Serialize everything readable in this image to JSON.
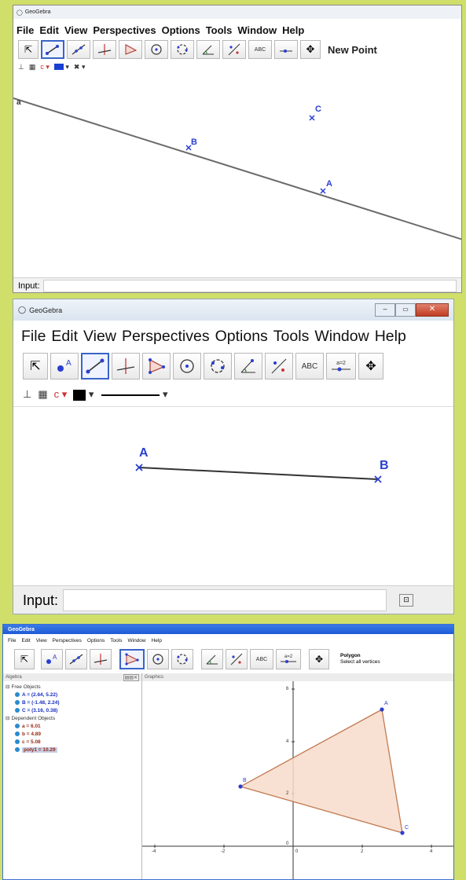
{
  "win1": {
    "title": "GeoGebra",
    "menu": [
      "File",
      "Edit",
      "View",
      "Perspectives",
      "Options",
      "Tools",
      "Window",
      "Help"
    ],
    "tool_label": "New Point",
    "input_label": "Input:",
    "points": {
      "a": "a",
      "b": "B",
      "c": "C",
      "A": "A"
    }
  },
  "win2": {
    "title": "GeoGebra",
    "menu": [
      "File",
      "Edit",
      "View",
      "Perspectives",
      "Options",
      "Tools",
      "Window",
      "Help"
    ],
    "abc": "ABC",
    "slider": "a=2",
    "input_label": "Input:",
    "points": {
      "A": "A",
      "B": "B"
    }
  },
  "win3": {
    "title": "GeoGebra",
    "menu": [
      "File",
      "Edit",
      "View",
      "Perspectives",
      "Options",
      "Tools",
      "Window",
      "Help"
    ],
    "abc": "ABC",
    "slider": "a=2",
    "tool_name": "Polygon",
    "tool_help": "Select all vertices",
    "algebra_title": "Algebra",
    "graphics_title": "Graphics",
    "free_header": "Free Objects",
    "free": [
      "A = (2.64, 5.22)",
      "B = (-1.48, 2.24)",
      "C = (3.16, 0.38)"
    ],
    "dep_header": "Dependent Objects",
    "dep": [
      "a = 6.01",
      "b = 4.89",
      "c = 5.08",
      "poly1 = 10.29"
    ],
    "points": {
      "A": "A",
      "B": "B",
      "C": "C"
    },
    "x_ticks": [
      "-4",
      "-2",
      "0",
      "2",
      "4"
    ],
    "y_ticks": [
      "6",
      "4",
      "2",
      "0"
    ]
  },
  "colors": {
    "accent": "#3a64c8",
    "point": "#2a3fd0",
    "polygon": "#c27a52",
    "title3": "#1d5bd8"
  }
}
